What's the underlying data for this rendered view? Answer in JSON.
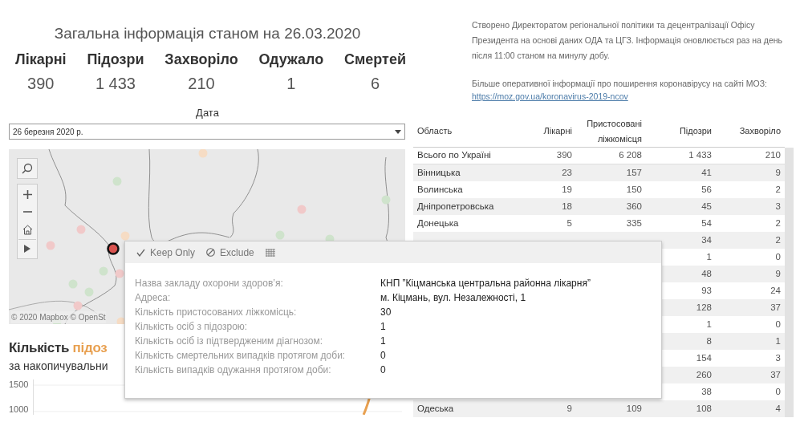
{
  "header": {
    "title": "Загальна інформація станом на 26.03.2020",
    "stats": [
      {
        "label": "Лікарні",
        "value": "390"
      },
      {
        "label": "Підозри",
        "value": "1 433"
      },
      {
        "label": "Захворіло",
        "value": "210"
      },
      {
        "label": "Одужало",
        "value": "1"
      },
      {
        "label": "Смертей",
        "value": "6"
      }
    ]
  },
  "info": {
    "paragraph": "Створено Директоратом регіональної політики та децентралізації Офісу Президента на основі даних ОДА та ЦГЗ. Інформація оновлюється раз на день після 11:00 станом на минулу добу.",
    "more": "Більше оперативної інформації про поширення коронавірусу на сайті МОЗ:",
    "link": "https://moz.gov.ua/koronavirus-2019-ncov"
  },
  "date_filter": {
    "label": "Дата",
    "value": "26 березня 2020 р."
  },
  "map": {
    "attribution": "© 2020 Mapbox © OpenSt"
  },
  "table": {
    "columns": [
      "Область",
      "Лікарні",
      "Пристосовані ліжкомісця",
      "Підозри",
      "Захворіло"
    ],
    "rows": [
      {
        "cells": [
          "Всього по Україні",
          "390",
          "6 208",
          "1 433",
          "210"
        ]
      },
      {
        "cells": [
          "Вінницька",
          "23",
          "157",
          "41",
          "9"
        ]
      },
      {
        "cells": [
          "Волинська",
          "19",
          "150",
          "56",
          "2"
        ]
      },
      {
        "cells": [
          "Дніпропетровська",
          "18",
          "360",
          "45",
          "3"
        ]
      },
      {
        "cells": [
          "Донецька",
          "5",
          "335",
          "54",
          "2"
        ]
      },
      {
        "cells": [
          "",
          "",
          "",
          "34",
          "2"
        ]
      },
      {
        "cells": [
          "",
          "",
          "",
          "1",
          "0"
        ]
      },
      {
        "cells": [
          "",
          "",
          "",
          "48",
          "9"
        ]
      },
      {
        "cells": [
          "",
          "",
          "",
          "93",
          "24"
        ]
      },
      {
        "cells": [
          "",
          "",
          "",
          "128",
          "37"
        ]
      },
      {
        "cells": [
          "",
          "",
          "",
          "1",
          "0"
        ]
      },
      {
        "cells": [
          "",
          "",
          "",
          "8",
          "1"
        ]
      },
      {
        "cells": [
          "",
          "",
          "",
          "154",
          "3"
        ]
      },
      {
        "cells": [
          "",
          "",
          "",
          "260",
          "37"
        ]
      },
      {
        "cells": [
          "",
          "",
          "",
          "38",
          "0"
        ]
      },
      {
        "cells": [
          "Одеська",
          "9",
          "109",
          "108",
          "4"
        ]
      }
    ]
  },
  "tooltip": {
    "actions": [
      {
        "kind": "keep",
        "label": "Keep Only"
      },
      {
        "kind": "exclude",
        "label": "Exclude"
      },
      {
        "kind": "data"
      }
    ],
    "fields": [
      {
        "label": "Назва закладу охорони здоров’я:",
        "value": "КНП ”Кіцманська центральна районна лікарня”"
      },
      {
        "label": "Адреса:",
        "value": "м. Кіцмань, вул. Незалежності, 1"
      },
      {
        "label": "Кількість пристосованих ліжкомісць:",
        "value": "30"
      },
      {
        "label": "Кількість осіб з підозрою:",
        "value": "1"
      },
      {
        "label": "Кількість осіб із підтвердженим діагнозом:",
        "value": "1"
      },
      {
        "label": "Кількість смертельних випадків протягом доби:",
        "value": "0"
      },
      {
        "label": "Кількість випадків одужання протягом доби:",
        "value": "0"
      }
    ]
  },
  "chart": {
    "title": "Кількість",
    "title_highlight": "підоз",
    "subtitle": "за накопичувальни",
    "y_ticks": [
      "1500",
      "1000"
    ]
  }
}
